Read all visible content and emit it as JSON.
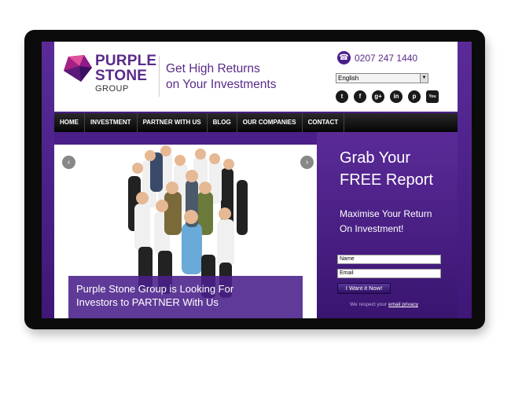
{
  "logo": {
    "line1": "PURPLE",
    "line2": "STONE",
    "line3": "GROUP"
  },
  "tagline": {
    "line1": "Get High Returns",
    "line2": "on Your Investments"
  },
  "contact": {
    "phone": "0207 247 1440"
  },
  "language": {
    "selected": "English"
  },
  "socials": [
    {
      "name": "twitter",
      "glyph": "t"
    },
    {
      "name": "facebook",
      "glyph": "f"
    },
    {
      "name": "google-plus",
      "glyph": "g+"
    },
    {
      "name": "linkedin",
      "glyph": "in"
    },
    {
      "name": "pinterest",
      "glyph": "p"
    },
    {
      "name": "youtube",
      "glyph": "You Tube"
    }
  ],
  "nav": [
    "HOME",
    "INVESTMENT",
    "PARTNER WITH US",
    "BLOG",
    "OUR COMPANIES",
    "CONTACT"
  ],
  "hero": {
    "caption_line1": "Purple Stone Group is Looking For",
    "caption_line2": "Investors to PARTNER With Us",
    "prev_glyph": "‹",
    "next_glyph": "›"
  },
  "sidebar": {
    "heading_line1": "Grab Your",
    "heading_line2": "FREE Report",
    "sub_line1": "Maximise Your Return",
    "sub_line2": "On Investment!",
    "name_placeholder": "Name",
    "email_placeholder": "Email",
    "submit_label": "I Want it Now!",
    "privacy_text": "We respect your",
    "privacy_link": "email privacy"
  },
  "colors": {
    "brand_purple": "#4a1f8a",
    "nav_black": "#0a0a0a"
  }
}
